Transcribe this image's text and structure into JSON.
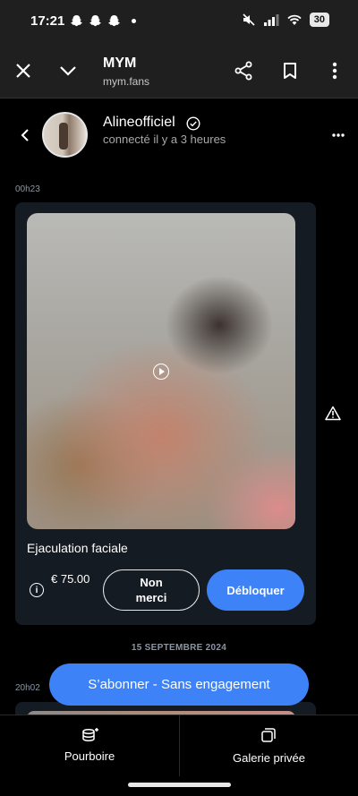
{
  "status_bar": {
    "time": "17:21",
    "battery": "30"
  },
  "browser": {
    "title": "MYM",
    "url": "mym.fans"
  },
  "chat": {
    "username": "Alineofficiel",
    "last_seen": "connecté il y a 3 heures"
  },
  "messages": [
    {
      "time": "00h23",
      "caption": "Ejaculation faciale",
      "price": "€ 75.00",
      "decline_label": "Non merci",
      "unlock_label": "Débloquer"
    },
    {
      "time": "20h02"
    }
  ],
  "date_separator": "15 SEPTEMBRE 2024",
  "subscribe_label": "S’abonner - Sans engagement",
  "bottom_tabs": [
    {
      "label": "Pourboire",
      "icon": "coins-icon"
    },
    {
      "label": "Galerie privée",
      "icon": "gallery-icon"
    }
  ],
  "colors": {
    "accent": "#3e82f7",
    "card_bg": "#151b23",
    "toolbar_bg": "#1f1f1f"
  }
}
